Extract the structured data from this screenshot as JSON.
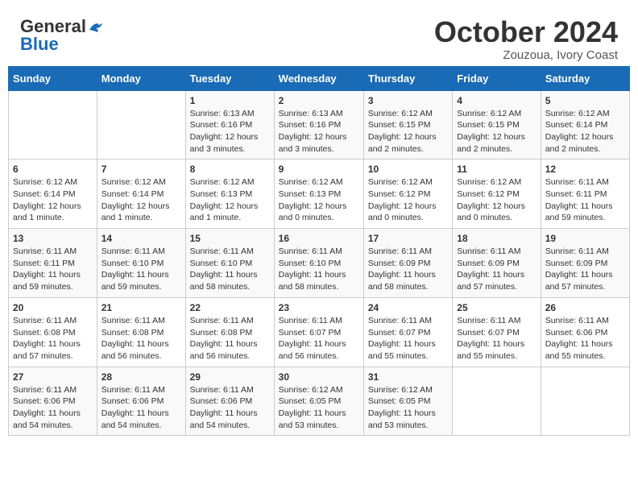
{
  "header": {
    "logo_line1": "General",
    "logo_line2": "Blue",
    "month": "October 2024",
    "location": "Zouzoua, Ivory Coast"
  },
  "weekdays": [
    "Sunday",
    "Monday",
    "Tuesday",
    "Wednesday",
    "Thursday",
    "Friday",
    "Saturday"
  ],
  "weeks": [
    [
      {
        "day": "",
        "info": ""
      },
      {
        "day": "",
        "info": ""
      },
      {
        "day": "1",
        "info": "Sunrise: 6:13 AM\nSunset: 6:16 PM\nDaylight: 12 hours and 3 minutes."
      },
      {
        "day": "2",
        "info": "Sunrise: 6:13 AM\nSunset: 6:16 PM\nDaylight: 12 hours and 3 minutes."
      },
      {
        "day": "3",
        "info": "Sunrise: 6:12 AM\nSunset: 6:15 PM\nDaylight: 12 hours and 2 minutes."
      },
      {
        "day": "4",
        "info": "Sunrise: 6:12 AM\nSunset: 6:15 PM\nDaylight: 12 hours and 2 minutes."
      },
      {
        "day": "5",
        "info": "Sunrise: 6:12 AM\nSunset: 6:14 PM\nDaylight: 12 hours and 2 minutes."
      }
    ],
    [
      {
        "day": "6",
        "info": "Sunrise: 6:12 AM\nSunset: 6:14 PM\nDaylight: 12 hours and 1 minute."
      },
      {
        "day": "7",
        "info": "Sunrise: 6:12 AM\nSunset: 6:14 PM\nDaylight: 12 hours and 1 minute."
      },
      {
        "day": "8",
        "info": "Sunrise: 6:12 AM\nSunset: 6:13 PM\nDaylight: 12 hours and 1 minute."
      },
      {
        "day": "9",
        "info": "Sunrise: 6:12 AM\nSunset: 6:13 PM\nDaylight: 12 hours and 0 minutes."
      },
      {
        "day": "10",
        "info": "Sunrise: 6:12 AM\nSunset: 6:12 PM\nDaylight: 12 hours and 0 minutes."
      },
      {
        "day": "11",
        "info": "Sunrise: 6:12 AM\nSunset: 6:12 PM\nDaylight: 12 hours and 0 minutes."
      },
      {
        "day": "12",
        "info": "Sunrise: 6:11 AM\nSunset: 6:11 PM\nDaylight: 11 hours and 59 minutes."
      }
    ],
    [
      {
        "day": "13",
        "info": "Sunrise: 6:11 AM\nSunset: 6:11 PM\nDaylight: 11 hours and 59 minutes."
      },
      {
        "day": "14",
        "info": "Sunrise: 6:11 AM\nSunset: 6:10 PM\nDaylight: 11 hours and 59 minutes."
      },
      {
        "day": "15",
        "info": "Sunrise: 6:11 AM\nSunset: 6:10 PM\nDaylight: 11 hours and 58 minutes."
      },
      {
        "day": "16",
        "info": "Sunrise: 6:11 AM\nSunset: 6:10 PM\nDaylight: 11 hours and 58 minutes."
      },
      {
        "day": "17",
        "info": "Sunrise: 6:11 AM\nSunset: 6:09 PM\nDaylight: 11 hours and 58 minutes."
      },
      {
        "day": "18",
        "info": "Sunrise: 6:11 AM\nSunset: 6:09 PM\nDaylight: 11 hours and 57 minutes."
      },
      {
        "day": "19",
        "info": "Sunrise: 6:11 AM\nSunset: 6:09 PM\nDaylight: 11 hours and 57 minutes."
      }
    ],
    [
      {
        "day": "20",
        "info": "Sunrise: 6:11 AM\nSunset: 6:08 PM\nDaylight: 11 hours and 57 minutes."
      },
      {
        "day": "21",
        "info": "Sunrise: 6:11 AM\nSunset: 6:08 PM\nDaylight: 11 hours and 56 minutes."
      },
      {
        "day": "22",
        "info": "Sunrise: 6:11 AM\nSunset: 6:08 PM\nDaylight: 11 hours and 56 minutes."
      },
      {
        "day": "23",
        "info": "Sunrise: 6:11 AM\nSunset: 6:07 PM\nDaylight: 11 hours and 56 minutes."
      },
      {
        "day": "24",
        "info": "Sunrise: 6:11 AM\nSunset: 6:07 PM\nDaylight: 11 hours and 55 minutes."
      },
      {
        "day": "25",
        "info": "Sunrise: 6:11 AM\nSunset: 6:07 PM\nDaylight: 11 hours and 55 minutes."
      },
      {
        "day": "26",
        "info": "Sunrise: 6:11 AM\nSunset: 6:06 PM\nDaylight: 11 hours and 55 minutes."
      }
    ],
    [
      {
        "day": "27",
        "info": "Sunrise: 6:11 AM\nSunset: 6:06 PM\nDaylight: 11 hours and 54 minutes."
      },
      {
        "day": "28",
        "info": "Sunrise: 6:11 AM\nSunset: 6:06 PM\nDaylight: 11 hours and 54 minutes."
      },
      {
        "day": "29",
        "info": "Sunrise: 6:11 AM\nSunset: 6:06 PM\nDaylight: 11 hours and 54 minutes."
      },
      {
        "day": "30",
        "info": "Sunrise: 6:12 AM\nSunset: 6:05 PM\nDaylight: 11 hours and 53 minutes."
      },
      {
        "day": "31",
        "info": "Sunrise: 6:12 AM\nSunset: 6:05 PM\nDaylight: 11 hours and 53 minutes."
      },
      {
        "day": "",
        "info": ""
      },
      {
        "day": "",
        "info": ""
      }
    ]
  ]
}
